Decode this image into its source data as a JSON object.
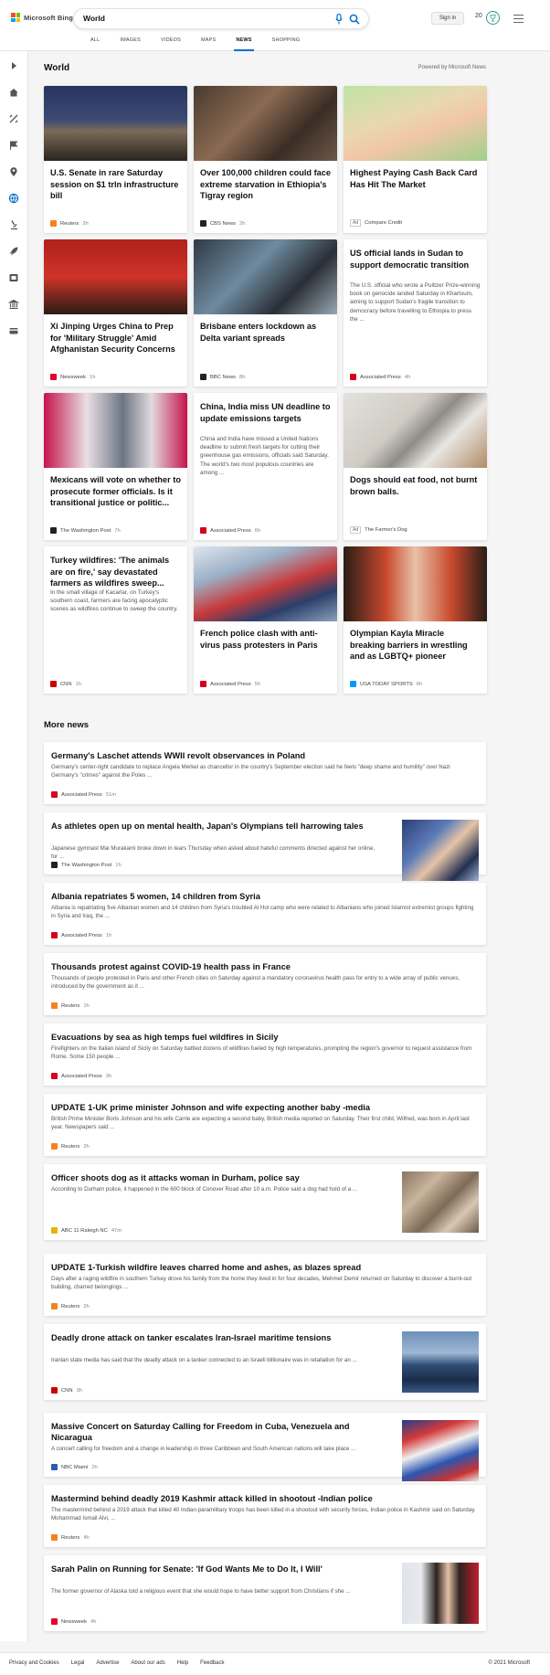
{
  "header": {
    "brand": "Microsoft Bing",
    "brand_colors": [
      "#f25022",
      "#7fba00",
      "#00a4ef",
      "#ffb900"
    ],
    "query": "World",
    "signin": "Sign in",
    "points": "20",
    "tabs": [
      "ALL",
      "IMAGES",
      "VIDEOS",
      "MAPS",
      "NEWS",
      "SHOPPING"
    ],
    "active_tab": "NEWS"
  },
  "rail": [
    "collapse-icon",
    "home-icon",
    "scale-icon",
    "flag-icon",
    "location-icon",
    "globe-icon",
    "microscope-icon",
    "rocket-icon",
    "film-icon",
    "building-icon",
    "card-icon"
  ],
  "section": {
    "title": "World",
    "powered_by": "Powered by Microsoft News"
  },
  "cards": [
    {
      "title": "U.S. Senate in rare Saturday session on $1 trln infrastructure bill",
      "snippet": "",
      "source": "Reuters",
      "time": "2h",
      "source_color": "#f58220",
      "thumb": "linear-gradient(180deg,#26345f 0%,#3c4a74 45%,#7b6a57 60%,#2a2420 100%)"
    },
    {
      "title": "Over 100,000 children could face extreme starvation in Ethiopia's Tigray region",
      "snippet": "",
      "source": "CBS News",
      "time": "2h",
      "source_color": "#222222",
      "thumb": "linear-gradient(135deg,#4a3a30 0%,#8b6a52 40%,#3b2d25 70%,#6d5848 100%)"
    },
    {
      "title": "Highest Paying Cash Back Card Has Hit The Market",
      "snippet": "",
      "source": "Compare Credit",
      "time": "",
      "ad": "Ad",
      "source_color": "",
      "thumb": "linear-gradient(160deg,#bfe3a4 0%,#e8d8b0 40%,#f2c6a8 60%,#9fd08a 100%)"
    },
    {
      "title": "Xi Jinping Urges China to Prep for 'Military Struggle' Amid Afghanistan Security Concerns",
      "snippet": "",
      "source": "Newsweek",
      "time": "1h",
      "source_color": "#e4002b",
      "thumb": "linear-gradient(180deg,#b0201c 0%,#cf3329 50%,#2a1c16 100%)"
    },
    {
      "title": "Brisbane enters lockdown as Delta variant spreads",
      "snippet": "",
      "source": "BBC News",
      "time": "8h",
      "source_color": "#222222",
      "thumb": "linear-gradient(135deg,#2f3a44 0%,#6f8aa0 40%,#2a2f36 70%,#9aa8b2 100%)"
    },
    {
      "title": "US official lands in Sudan to support democratic transition",
      "snippet": "The U.S. official who wrote a Pulitzer Prize-winning book on genocide landed Saturday in Khartoum, aiming to support Sudan's fragile transition to democracy before travelling to Ethiopia to press the ...",
      "source": "Associated Press",
      "time": "4h",
      "source_color": "#d6001c",
      "thumb": ""
    },
    {
      "title": "Mexicans will vote on whether to prosecute former officials. Is it transitional justice or politic...",
      "snippet": "",
      "source": "The Washington Post",
      "time": "7h",
      "source_color": "#222222",
      "thumb": "linear-gradient(90deg,#c4144a 0%,#e8e0e4 30%,#6d7584 55%,#e2dadf 75%,#c4144a 100%)"
    },
    {
      "title": "China, India miss UN deadline to update emissions targets",
      "snippet": "China and India have missed a United Nations deadline to submit fresh targets for cutting their greenhouse gas emissions, officials said Saturday. The world's two most populous countries are among ...",
      "source": "Associated Press",
      "time": "6h",
      "source_color": "#d6001c",
      "thumb": ""
    },
    {
      "title": "Dogs should eat food, not burnt brown balls.",
      "snippet": "",
      "source": "The Farmer's Dog",
      "time": "",
      "ad": "Ad",
      "source_color": "",
      "thumb": "linear-gradient(135deg,#e4e2de 0%,#cfcbc4 40%,#8f8b86 55%,#e8e6e2 70%,#b08b66 100%)"
    },
    {
      "title": "Turkey wildfires: 'The animals are on fire,' say devastated farmers as wildfires sweep...",
      "snippet": "In the small village of Kacarlar, on Turkey's southern coast, farmers are facing apocalyptic scenes as wildfires continue to sweep the country.",
      "source": "CNN",
      "time": "1h",
      "source_color": "#cc0000",
      "thumb": ""
    },
    {
      "title": "French police clash with anti-virus pass protesters in Paris",
      "snippet": "",
      "source": "Associated Press",
      "time": "5h",
      "source_color": "#d6001c",
      "thumb": "linear-gradient(160deg,#dfe6ee 0%,#9bb0c6 30%,#c83a3a 55%,#2c3e6b 75%,#8aa0b8 100%)"
    },
    {
      "title": "Olympian Kayla Miracle breaking barriers in wrestling and as LGBTQ+ pioneer",
      "snippet": "",
      "source": "USA TODAY SPORTS",
      "time": "6h",
      "source_color": "#009bff",
      "thumb": "linear-gradient(90deg,#2a1c16 0%,#c94a2e 30%,#e7c2a8 50%,#c94a2e 75%,#2a1c16 100%)"
    }
  ],
  "more_news": {
    "title": "More news",
    "items": [
      {
        "title": "Germany's Laschet attends WWII revolt observances in Poland",
        "snippet": "Germany's center-right candidate to replace Angela Merkel as chancellor in the country's September election said he feels \"deep shame and humility\" over Nazi Germany's \"crimes\" against the Poles ...",
        "source": "Associated Press",
        "time": "51m",
        "source_color": "#d6001c",
        "thumb": ""
      },
      {
        "title": "As athletes open up on mental health, Japan's Olympians tell harrowing tales",
        "snippet": "Japanese gymnast Mai Murakami broke down in tears Thursday when asked about hateful comments directed against her online, for ...",
        "source": "The Washington Post",
        "time": "1h",
        "source_color": "#222222",
        "thumb": "linear-gradient(135deg,#2c3f77 0%,#5c7bb8 35%,#e6c4a8 55%,#22304f 80%,#9fb2d4 100%)"
      },
      {
        "title": "Albania repatriates 5 women, 14 children from Syria",
        "snippet": "Albania is repatriating five Albanian women and 14 children from Syria's troubled Al Hol camp who were related to Albanians who joined Islamist extremist groups fighting in Syria and Iraq, the ...",
        "source": "Associated Press",
        "time": "1h",
        "source_color": "#d6001c",
        "thumb": ""
      },
      {
        "title": "Thousands protest against COVID-19 health pass in France",
        "snippet": "Thousands of people protested in Paris and other French cities on Saturday against a mandatory coronavirus health pass for entry to a wide array of public venues, introduced by the government as it ...",
        "source": "Reuters",
        "time": "1h",
        "source_color": "#f58220",
        "thumb": ""
      },
      {
        "title": "Evacuations by sea as high temps fuel wildfires in Sicily",
        "snippet": "Firefighters on the Italian island of Sicily on Saturday battled dozens of wildfires fueled by high temperatures, prompting the region's governor to request assistance from Rome. Some 150 people ...",
        "source": "Associated Press",
        "time": "3h",
        "source_color": "#d6001c",
        "thumb": ""
      },
      {
        "title": "UPDATE 1-UK prime minister Johnson and wife expecting another baby -media",
        "snippet": "British Prime Minister Boris Johnson and his wife Carrie are expecting a second baby, British media reported on Saturday. Their first child, Wilfred, was born in April last year. Newspapers said ...",
        "source": "Reuters",
        "time": "2h",
        "source_color": "#f58220",
        "thumb": ""
      },
      {
        "title": "Officer shoots dog as it attacks woman in Durham, police say",
        "snippet": "According to Durham police, it happened in the 600 block of Conover Road after 10 a.m. Police said a dog had hold of a ...",
        "source": "ABC 11 Raleigh NC",
        "time": "47m",
        "source_color": "#e8b400",
        "thumb": "linear-gradient(135deg,#8a7560 0%,#c9b59c 30%,#7d6a58 55%,#d8c8b4 75%,#6a5a48 100%)"
      },
      {
        "title": "UPDATE 1-Turkish wildfire leaves charred home and ashes, as blazes spread",
        "snippet": "Days after a raging wildfire in southern Turkey drove his family from the home they lived in for four decades, Mehmet Demir returned on Saturday to discover a burnt-out building, charred belongings ...",
        "source": "Reuters",
        "time": "2h",
        "source_color": "#f58220",
        "thumb": ""
      },
      {
        "title": "Deadly drone attack on tanker escalates Iran-Israel maritime tensions",
        "snippet": "Iranian state media has said that the deadly attack on a tanker connected to an Israeli billionaire was in retaliation for an ...",
        "source": "CNN",
        "time": "3h",
        "source_color": "#cc0000",
        "thumb": "linear-gradient(180deg,#6d8fb8 0%,#9eb8d4 35%,#2f4d76 55%,#1b2c49 80%,#3a5a86 100%)"
      },
      {
        "title": "Massive Concert on Saturday Calling for Freedom in Cuba, Venezuela and Nicaragua",
        "snippet": "A concert calling for freedom and a change in leadership in three Caribbean and South American nations will take place ...",
        "source": "NBC Miami",
        "time": "2h",
        "source_color": "#2a5db0",
        "thumb": "linear-gradient(160deg,#1f3f8c 0%,#d43a3a 25%,#f1f1f1 45%,#2b56b0 65%,#c83232 85%,#e8e8e8 100%)"
      },
      {
        "title": "Mastermind behind deadly 2019 Kashmir attack killed in shootout -Indian police",
        "snippet": "The mastermind behind a 2019 attack that killed 40 Indian paramilitary troops has been killed in a shootout with security forces, Indian police in Kashmir said on Saturday. Mohammad Ismail Alvi, ...",
        "source": "Reuters",
        "time": "4h",
        "source_color": "#f58220",
        "thumb": ""
      },
      {
        "title": "Sarah Palin on Running for Senate: 'If God Wants Me to Do It, I Will'",
        "snippet": "The former governor of Alaska told a religious event that she would hope to have better support from Christians if she ...",
        "source": "Newsweek",
        "time": "4h",
        "source_color": "#e4002b",
        "thumb": "linear-gradient(90deg,#dfe4ec 0%,#e9e9ee 25%,#2a2320 45%,#e6c0a8 60%,#2a2320 75%,#c21f2f 100%)"
      }
    ]
  },
  "footer": {
    "links": [
      "Privacy and Cookies",
      "Legal",
      "Advertise",
      "About our ads",
      "Help",
      "Feedback"
    ],
    "copyright": "© 2021 Microsoft"
  }
}
